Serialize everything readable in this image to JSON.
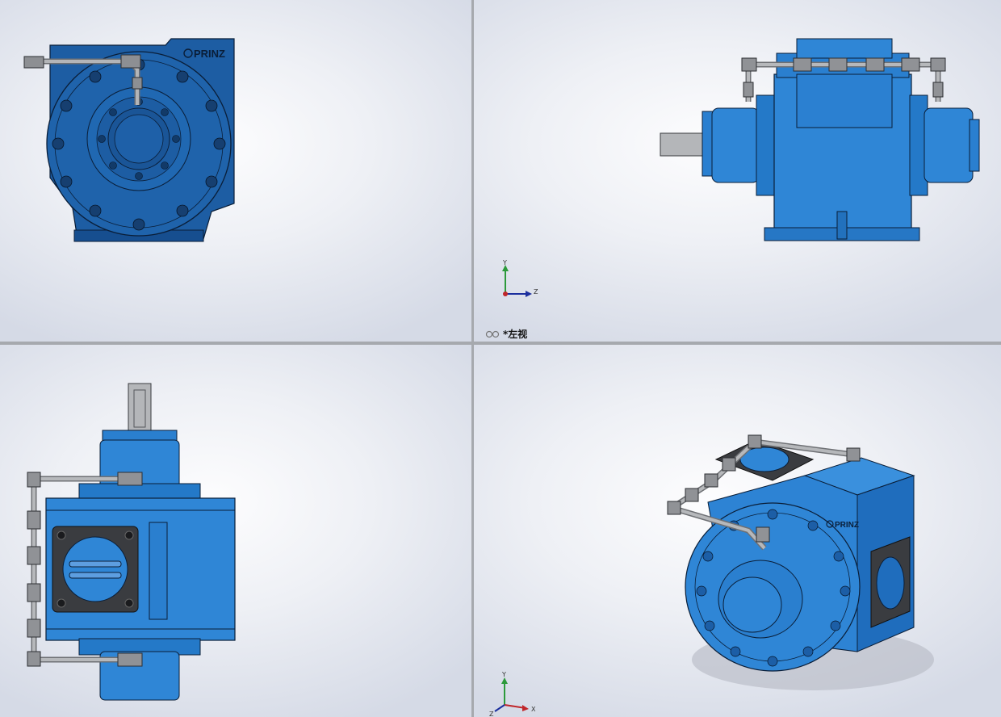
{
  "viewports": {
    "top_left": {
      "brand": "PRINZ"
    },
    "top_right": {
      "view_label": "*左视",
      "triad": {
        "x": "",
        "y": "Y",
        "z": "Z"
      }
    },
    "bottom_left": {},
    "bottom_right": {
      "brand": "PRINZ",
      "triad": {
        "x": "X",
        "y": "Y",
        "z": "Z"
      }
    }
  },
  "colors": {
    "body_blue": "#1c5ea6",
    "body_blue_dark": "#0d3f7a",
    "body_blue_light": "#2f86d6",
    "steel": "#a8aaad",
    "gasket": "#3a3c40",
    "edge": "#0a1e38",
    "background": "#eef0f5"
  }
}
